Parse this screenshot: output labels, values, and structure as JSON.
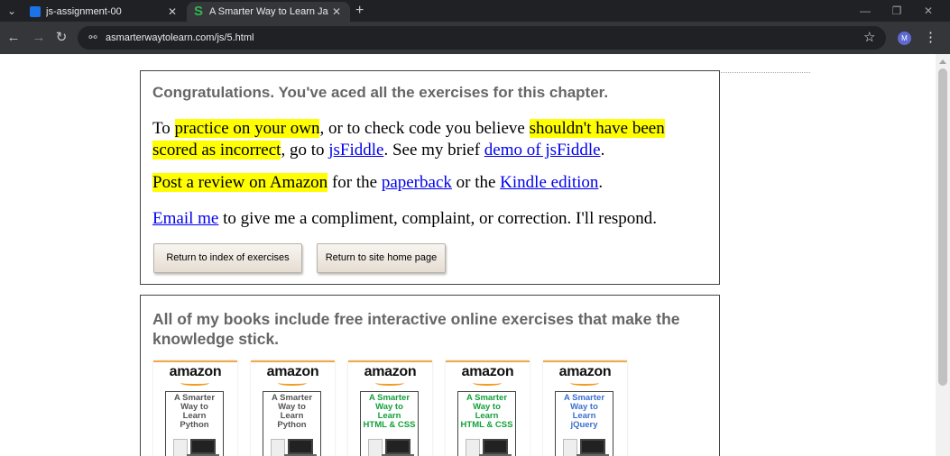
{
  "browser": {
    "tabs": [
      {
        "title": "js-assignment-00",
        "active": false
      },
      {
        "title": "A Smarter Way to Learn JavaScr",
        "active": true
      }
    ],
    "tab_list_glyph": "⌄",
    "new_tab_glyph": "+",
    "close_glyph": "✕",
    "url": "asmarterwaytolearn.com/js/5.html",
    "avatar_letter": "M",
    "icons": {
      "back": "←",
      "forward": "→",
      "reload": "↻",
      "site_info": "⚯",
      "star": "☆",
      "menu": "⋮",
      "minimize": "—",
      "restore": "❐",
      "close": "✕"
    },
    "colors": {
      "tabbar": "#202124",
      "toolbar": "#35363a",
      "avatar": "#5e6ad2"
    }
  },
  "page": {
    "box1": {
      "congrats": "Congratulations. You've aced all the exercises for this chapter.",
      "p1": {
        "t1": "To ",
        "h1": "practice on your own",
        "t2": ", or to check code you believe ",
        "h2": "shouldn't have been scored as incorrect",
        "t3": ", go to ",
        "link_jsfiddle": "jsFiddle",
        "t4": ". See my brief ",
        "link_demo": "demo of jsFiddle",
        "t5": "."
      },
      "p2": {
        "h1": "Post a review on Amazon",
        "t1": " for the ",
        "link_paperback": "paperback",
        "t2": " or the ",
        "link_kindle": "Kindle edition",
        "t3": "."
      },
      "p3": {
        "link_email": "Email me",
        "t1": " to give me a compliment, complaint, or correction. I'll respond."
      },
      "buttons": {
        "index": "Return to index of exercises",
        "home": "Return to site home page"
      }
    },
    "box2": {
      "heading": "All of my books include free interactive online exercises that make the knowledge stick.",
      "books": [
        {
          "brand": "amazon",
          "title_lines": [
            "A Smarter",
            "Way to",
            "Learn",
            "Python"
          ],
          "color": "#555555"
        },
        {
          "brand": "amazon",
          "title_lines": [
            "A Smarter",
            "Way to",
            "Learn",
            "Python"
          ],
          "color": "#555555"
        },
        {
          "brand": "amazon",
          "title_lines": [
            "A Smarter",
            "Way to",
            "Learn",
            "HTML & CSS"
          ],
          "color": "#12a03a"
        },
        {
          "brand": "amazon",
          "title_lines": [
            "A Smarter",
            "Way to",
            "Learn",
            "HTML & CSS"
          ],
          "color": "#12a03a"
        },
        {
          "brand": "amazon",
          "title_lines": [
            "A Smarter",
            "Way to",
            "Learn",
            "jQuery"
          ],
          "color": "#3a6fd0"
        }
      ]
    },
    "highlight_color": "#ffff00",
    "link_color": "#0000ee"
  }
}
